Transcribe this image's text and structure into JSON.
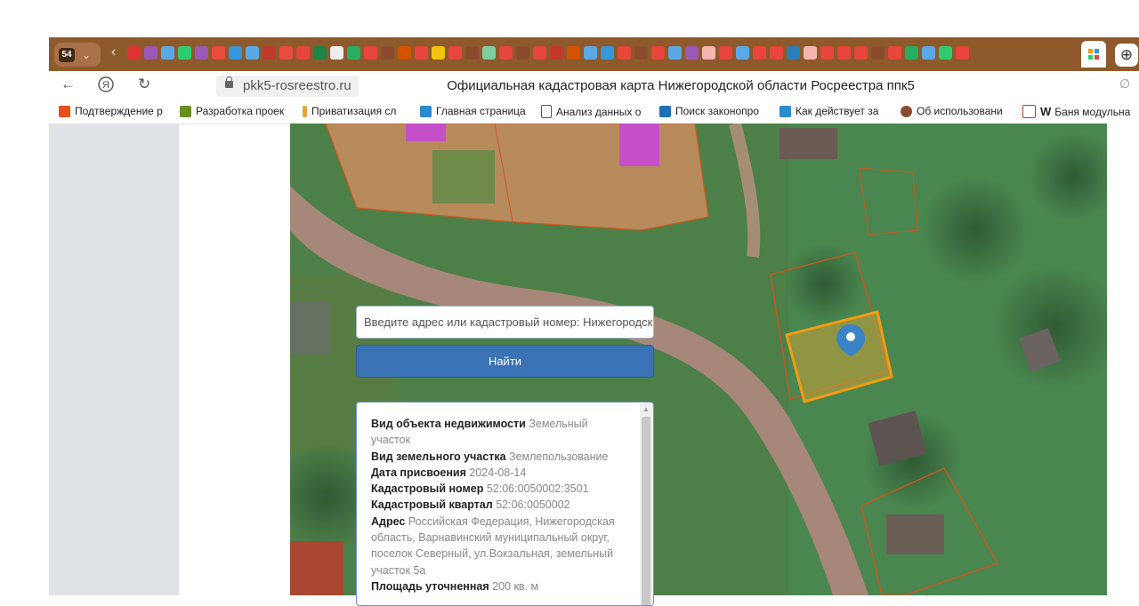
{
  "browser": {
    "tab_count": "54",
    "url": "pkk5-rosreestro.ru",
    "page_title": "Официальная кадастровая карта Нижегородской области Росреестра ппк5"
  },
  "bookmarks": [
    {
      "label": "Подтверждение р",
      "color": "#e94e1b"
    },
    {
      "label": "Разработка проек",
      "color": "#6b8e23"
    },
    {
      "label": "Приватизация сл",
      "color": "#e8a33d"
    },
    {
      "label": "Главная страница",
      "color": "#2a8bd1"
    },
    {
      "label": "Анализ данных о",
      "color": "#555555"
    },
    {
      "label": "Поиск законопро",
      "color": "#1e6fb8"
    },
    {
      "label": "Как действует за",
      "color": "#2a8bd1"
    },
    {
      "label": "Об использовани",
      "color": "#8a4b2d"
    },
    {
      "label": "Баня модульна",
      "color": "#c0392b"
    }
  ],
  "search": {
    "placeholder": "Введите адрес или кадастровый номер: Нижегородская область",
    "button": "Найти"
  },
  "info": {
    "object_type_label": "Вид объекта недвижимости",
    "object_type_value": "Земельный участок",
    "land_type_label": "Вид земельного участка",
    "land_type_value": "Землепользование",
    "date_label": "Дата присвоения",
    "date_value": "2024-08-14",
    "cadastral_number_label": "Кадастровый номер",
    "cadastral_number_value": "52:06:0050002:3501",
    "quarter_label": "Кадастровый квартал",
    "quarter_value": "52:06:0050002",
    "address_label": "Адрес",
    "address_value": "Российская Федерация, Нижегородская область, Варнавинский муниципальный округ, поселок Северный, ул.Вокзальная, земельный участок 5а",
    "area_label": "Площадь уточненная",
    "area_value": "200 кв. м"
  }
}
